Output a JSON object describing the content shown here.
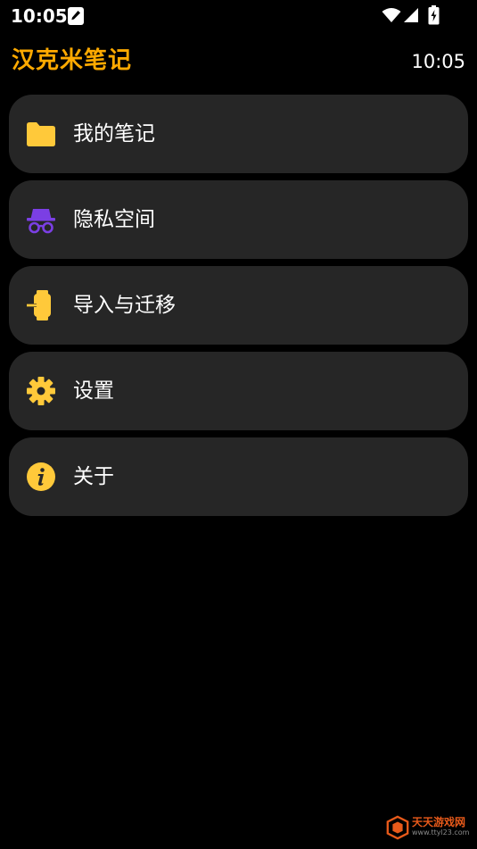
{
  "status_bar": {
    "time": "10:05"
  },
  "header": {
    "title": "汉克米笔记",
    "time": "10:05"
  },
  "colors": {
    "background": "#000000",
    "card": "#262626",
    "title_accent": "#ffaa00",
    "icon_yellow": "#ffc93a",
    "icon_purple": "#7b3fe4"
  },
  "menu": {
    "items": [
      {
        "label": "我的笔记",
        "icon": "folder-icon"
      },
      {
        "label": "隐私空间",
        "icon": "incognito-icon"
      },
      {
        "label": "导入与迁移",
        "icon": "import-icon"
      },
      {
        "label": "设置",
        "icon": "gear-icon"
      },
      {
        "label": "关于",
        "icon": "info-icon"
      }
    ]
  },
  "watermark": {
    "main": "天天游戏网",
    "sub": "www.ttyl23.com"
  }
}
